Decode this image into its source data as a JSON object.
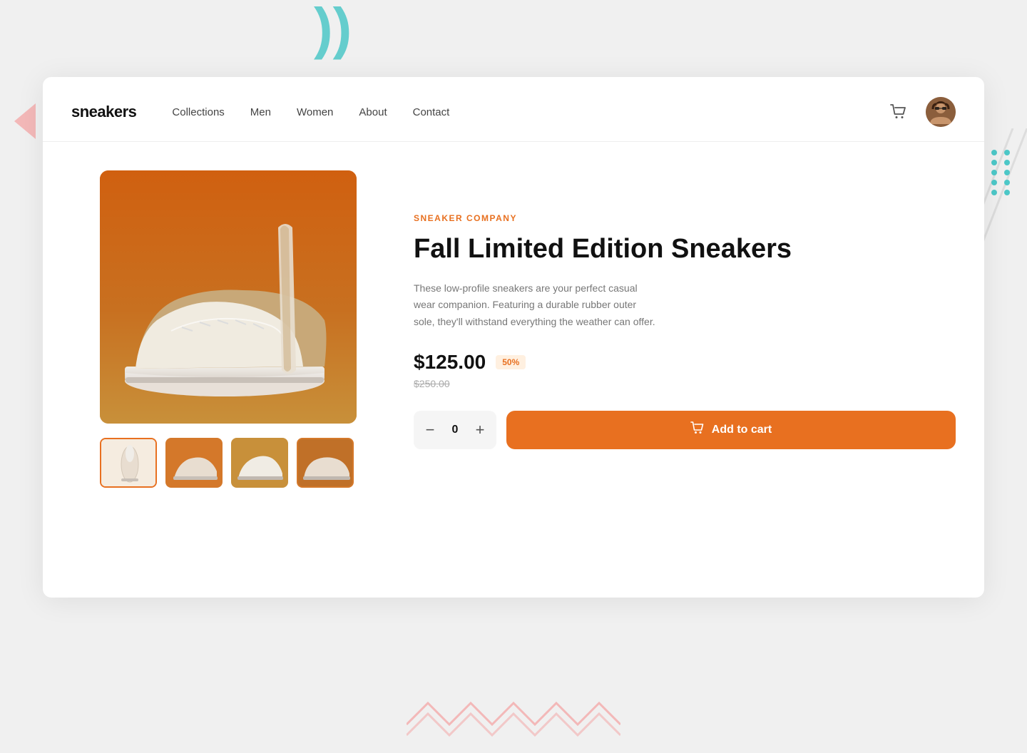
{
  "brand_name": "sneakers",
  "nav": {
    "links": [
      {
        "label": "Collections",
        "id": "collections"
      },
      {
        "label": "Men",
        "id": "men"
      },
      {
        "label": "Women",
        "id": "women"
      },
      {
        "label": "About",
        "id": "about"
      },
      {
        "label": "Contact",
        "id": "contact"
      }
    ]
  },
  "product": {
    "brand_label": "Sneaker Company",
    "title": "Fall Limited Edition Sneakers",
    "description": "These low-profile sneakers are your perfect casual wear companion. Featuring a durable rubber outer sole, they'll withstand everything the weather can offer.",
    "price_current": "$125.00",
    "price_original": "$250.00",
    "discount": "50%",
    "quantity": "0"
  },
  "buttons": {
    "add_to_cart": "Add to cart",
    "qty_minus": "−",
    "qty_plus": "+"
  }
}
